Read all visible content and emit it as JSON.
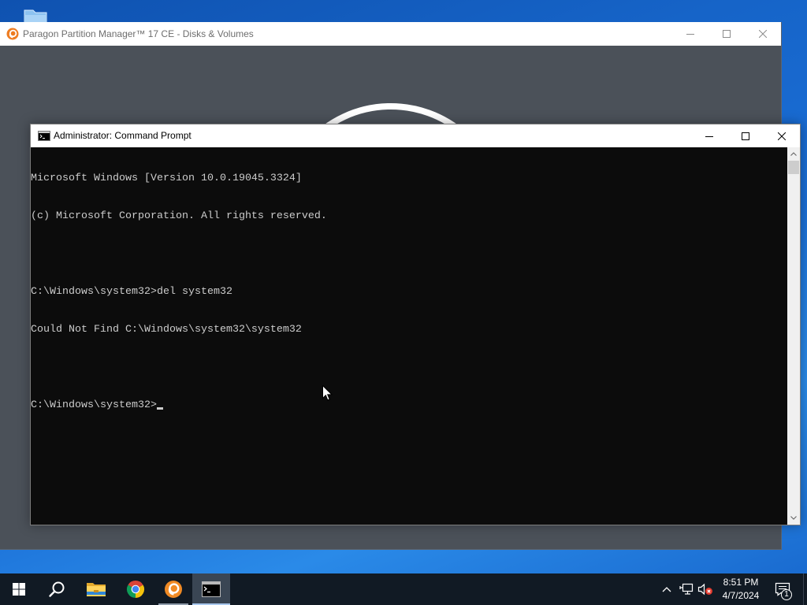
{
  "theme": {
    "desktop_background": "#1a6ed6",
    "taskbar_background": "#111a24",
    "console_background": "#0c0c0c",
    "console_text": "#cccccc",
    "paragon_background": "#4b5159",
    "active_button_background": "#3a4654"
  },
  "desktop": {
    "shortcut_icon": "desktop-shortcut-icon"
  },
  "paragon_window": {
    "title": "Paragon Partition Manager™ 17 CE - Disks & Volumes",
    "icon": "paragon-logo-icon",
    "active": false,
    "loading_indicator": "loading-spinner"
  },
  "cmd_window": {
    "title": "Administrator: Command Prompt",
    "icon": "cmd-icon",
    "active": true,
    "lines": [
      "Microsoft Windows [Version 10.0.19045.3324]",
      "(c) Microsoft Corporation. All rights reserved.",
      "",
      "C:\\Windows\\system32>del system32",
      "Could Not Find C:\\Windows\\system32\\system32",
      "",
      "C:\\Windows\\system32>"
    ],
    "scrollbar_position": 0
  },
  "taskbar": {
    "buttons": [
      {
        "icon": "windows-start-icon",
        "running": false,
        "active": false
      },
      {
        "icon": "search-icon",
        "running": false,
        "active": false
      },
      {
        "icon": "file-explorer-icon",
        "running": false,
        "active": false
      },
      {
        "icon": "chrome-icon",
        "running": false,
        "active": false
      },
      {
        "icon": "paragon-app-icon",
        "running": true,
        "active": false
      },
      {
        "icon": "command-prompt-icon",
        "running": true,
        "active": true
      }
    ],
    "tray": [
      "show-hidden-icons-chevron-icon",
      "network-icon",
      "volume-muted-icon",
      "action-center-icon"
    ],
    "clock": {
      "time": "8:51 PM",
      "date": "4/7/2024"
    },
    "notification_count": "1"
  },
  "pointer": {
    "icon": "mouse-pointer-icon"
  }
}
